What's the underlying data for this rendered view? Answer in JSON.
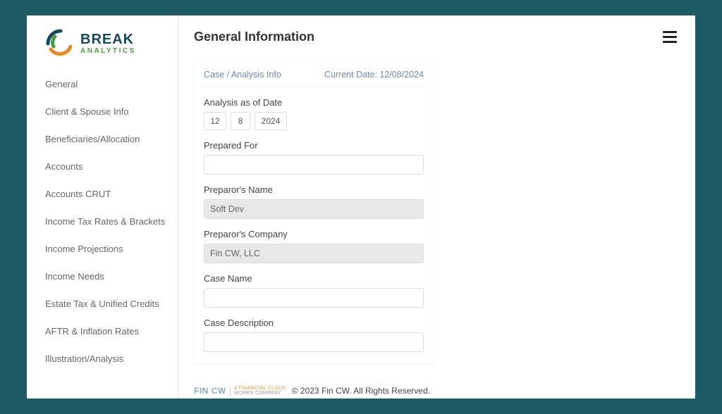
{
  "logo": {
    "main": "BREAK",
    "sub": "ANALYTICS"
  },
  "sidebar": {
    "items": [
      {
        "label": "General"
      },
      {
        "label": "Client & Spouse Info"
      },
      {
        "label": "Beneficiaries/Allocation"
      },
      {
        "label": "Accounts"
      },
      {
        "label": "Accounts CRUT"
      },
      {
        "label": "Income Tax Rates & Brackets"
      },
      {
        "label": "Income Projections"
      },
      {
        "label": "Income Needs"
      },
      {
        "label": "Estate Tax & Unified Credits"
      },
      {
        "label": "AFTR & Inflation Rates"
      },
      {
        "label": "Illustration/Analysis"
      }
    ]
  },
  "header": {
    "title": "General Information"
  },
  "card": {
    "section_title": "Case / Analysis Info",
    "current_date_label": "Current Date: 12/08/2024",
    "labels": {
      "analysis_date": "Analysis as of Date",
      "prepared_for": "Prepared For",
      "preparor_name": "Preparor's Name",
      "preparor_company": "Preparor's Company",
      "case_name": "Case Name",
      "case_description": "Case Description"
    },
    "date": {
      "mm": "12",
      "dd": "8",
      "yyyy": "2024"
    },
    "values": {
      "prepared_for": "",
      "preparor_name": "Soft Dev",
      "preparor_company": "Fin CW, LLC",
      "case_name": "",
      "case_description": ""
    }
  },
  "footer": {
    "brand": "FIN CW",
    "tag1": "A FINANCIAL CLOUD",
    "tag2": "WORKS COMPANY",
    "copyright": "© 2023 Fin CW. All Rights Reserved."
  }
}
